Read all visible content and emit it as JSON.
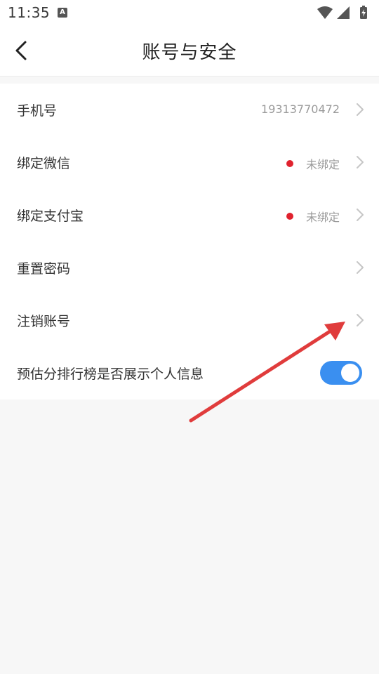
{
  "status_bar": {
    "time": "11:35",
    "notification_icon": "a-badge-icon",
    "icons": [
      "wifi-icon",
      "signal-icon",
      "battery-charging-icon"
    ]
  },
  "header": {
    "title": "账号与安全",
    "back_icon": "chevron-left-icon"
  },
  "settings": {
    "phone": {
      "label": "手机号",
      "value": "19313770472"
    },
    "wechat": {
      "label": "绑定微信",
      "value": "未绑定",
      "unbound_dot_color": "#e0222e"
    },
    "alipay": {
      "label": "绑定支付宝",
      "value": "未绑定",
      "unbound_dot_color": "#e0222e"
    },
    "reset_password": {
      "label": "重置密码"
    },
    "delete_account": {
      "label": "注销账号"
    },
    "ranking_display": {
      "label": "预估分排行榜是否展示个人信息",
      "toggle_on": true
    }
  },
  "colors": {
    "toggle_on": "#3a8ff0",
    "annotation_arrow": "#e03c3c",
    "background": "#f7f7f7"
  }
}
